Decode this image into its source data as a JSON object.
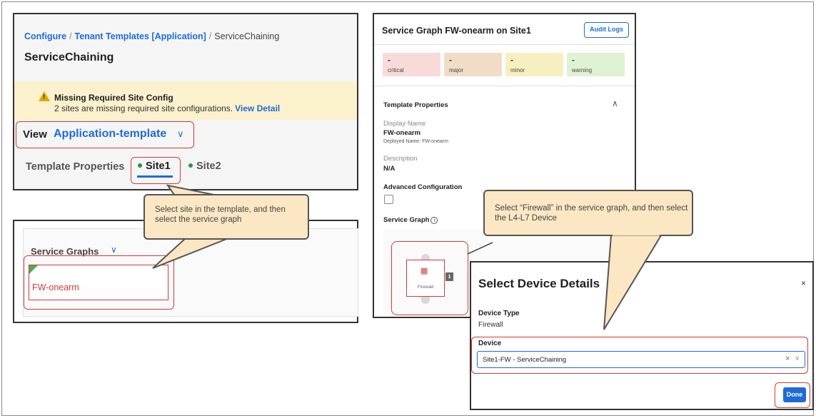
{
  "breadcrumb": {
    "item1": "Configure",
    "sep": "/",
    "item2": "Tenant Templates [Application]",
    "item3": "ServiceChaining"
  },
  "page": {
    "title": "ServiceChaining"
  },
  "warning": {
    "icon": "warning-icon",
    "title": "Missing Required Site Config",
    "body": "2 sites are missing required site configurations.",
    "link": "View Detail"
  },
  "view": {
    "label": "View",
    "value": "Application-template",
    "chevron": "∨"
  },
  "tabs": [
    {
      "label": "Template Properties"
    },
    {
      "label": "Site1"
    },
    {
      "label": "Site2"
    }
  ],
  "callout_site": "Select site in the template, and then select the service graph",
  "service_graphs": {
    "heading": "Service Graphs",
    "chevron": "∨",
    "item": "FW-onearm"
  },
  "graph_panel": {
    "title": "Service Graph FW-onearm on Site1",
    "audit_label": "Audit Logs",
    "severity": [
      {
        "count": "-",
        "label": "critical",
        "color": "#f9dada"
      },
      {
        "count": "-",
        "label": "major",
        "color": "#f1dcc6"
      },
      {
        "count": "-",
        "label": "minor",
        "color": "#f6efc0"
      },
      {
        "count": "-",
        "label": "warning",
        "color": "#dff2d2"
      }
    ],
    "template_props": "Template Properties",
    "collapse_icon": "∧",
    "display_name_label": "Display Name",
    "display_name_value": "FW-onearm",
    "deployed_name": "Deployed Name: FW-onearm",
    "description_label": "Description",
    "description_value": "N/A",
    "advanced_label": "Advanced Configuration",
    "service_graph_label": "Service Graph",
    "node_label": "Firewall",
    "node_badge": "1"
  },
  "callout_firewall": "Select “Firewall” in the service graph, and then select the L4-L7 Device",
  "device_modal": {
    "title": "Select Device Details",
    "close": "×",
    "device_type_label": "Device Type",
    "device_type_value": "Firewall",
    "device_label": "Device",
    "device_value": "Site1-FW - ServiceChaining",
    "clear": "×",
    "chevron": "∨",
    "done": "Done"
  }
}
